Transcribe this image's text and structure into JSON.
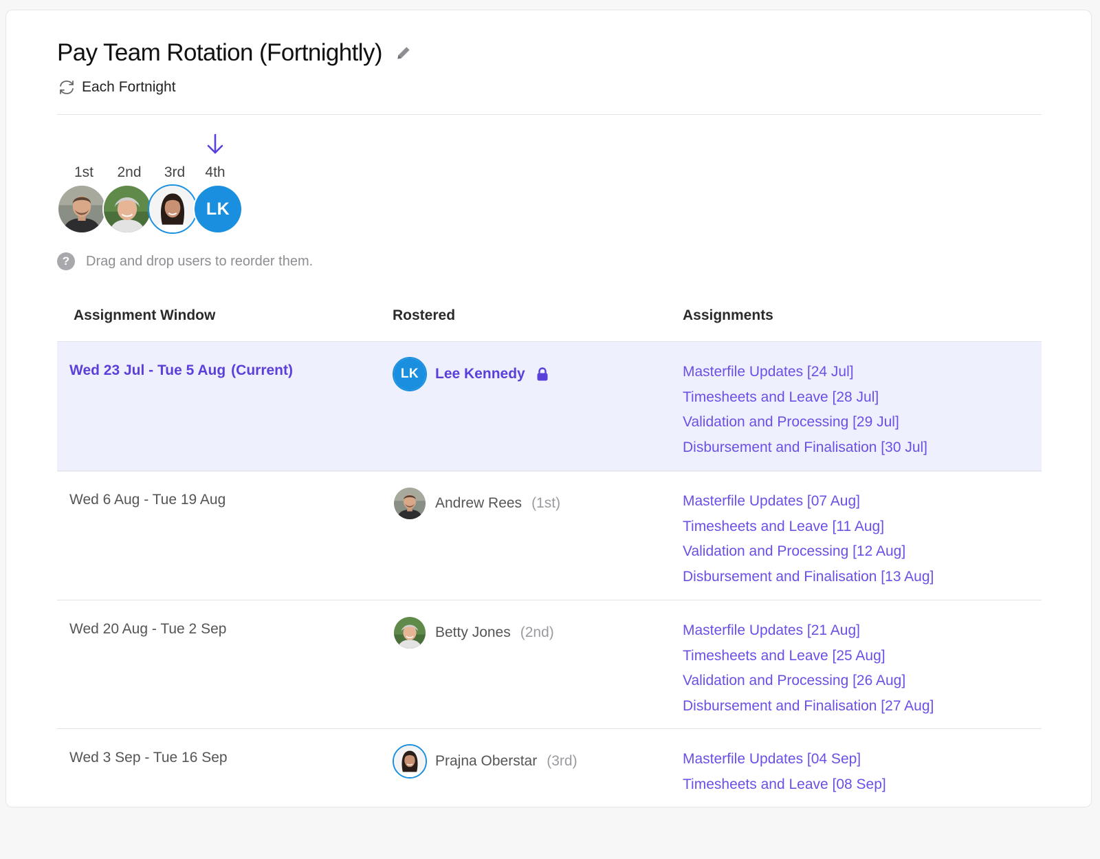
{
  "header": {
    "title": "Pay Team Rotation (Fortnightly)",
    "frequency": "Each Fortnight"
  },
  "order": {
    "labels": [
      "1st",
      "2nd",
      "3rd",
      "4th"
    ],
    "current_index": 3,
    "users": [
      {
        "name": "Andrew Rees",
        "initials": ""
      },
      {
        "name": "Betty Jones",
        "initials": ""
      },
      {
        "name": "Prajna Oberstar",
        "initials": ""
      },
      {
        "name": "Lee Kennedy",
        "initials": "LK"
      }
    ]
  },
  "hint": {
    "text": "Drag and drop users to reorder them."
  },
  "table": {
    "columns": [
      "Assignment Window",
      "Rostered",
      "Assignments"
    ],
    "rows": [
      {
        "window": "Wed 23 Jul - Tue 5 Aug",
        "status": "(Current)",
        "user": "Lee Kennedy",
        "initials": "LK",
        "order": "",
        "locked": true,
        "assignments": [
          "Masterfile Updates [24 Jul]",
          "Timesheets and Leave [28 Jul]",
          "Validation and Processing [29 Jul]",
          "Disbursement and Finalisation [30 Jul]"
        ]
      },
      {
        "window": "Wed 6 Aug - Tue 19 Aug",
        "status": "",
        "user": "Andrew Rees",
        "order": "(1st)",
        "assignments": [
          "Masterfile Updates [07 Aug]",
          "Timesheets and Leave [11 Aug]",
          "Validation and Processing [12 Aug]",
          "Disbursement and Finalisation [13 Aug]"
        ]
      },
      {
        "window": "Wed 20 Aug - Tue 2 Sep",
        "status": "",
        "user": "Betty Jones",
        "order": "(2nd)",
        "assignments": [
          "Masterfile Updates [21 Aug]",
          "Timesheets and Leave [25 Aug]",
          "Validation and Processing [26 Aug]",
          "Disbursement and Finalisation [27 Aug]"
        ]
      },
      {
        "window": "Wed 3 Sep - Tue 16 Sep",
        "status": "",
        "user": "Prajna Oberstar",
        "order": "(3rd)",
        "assignments": [
          "Masterfile Updates [04 Sep]",
          "Timesheets and Leave [08 Sep]"
        ]
      }
    ]
  },
  "colors": {
    "accent": "#5b3fd9",
    "link": "#6b4fe6",
    "avatar_blue": "#1a8fe0",
    "current_row_bg": "#eef0fd"
  }
}
